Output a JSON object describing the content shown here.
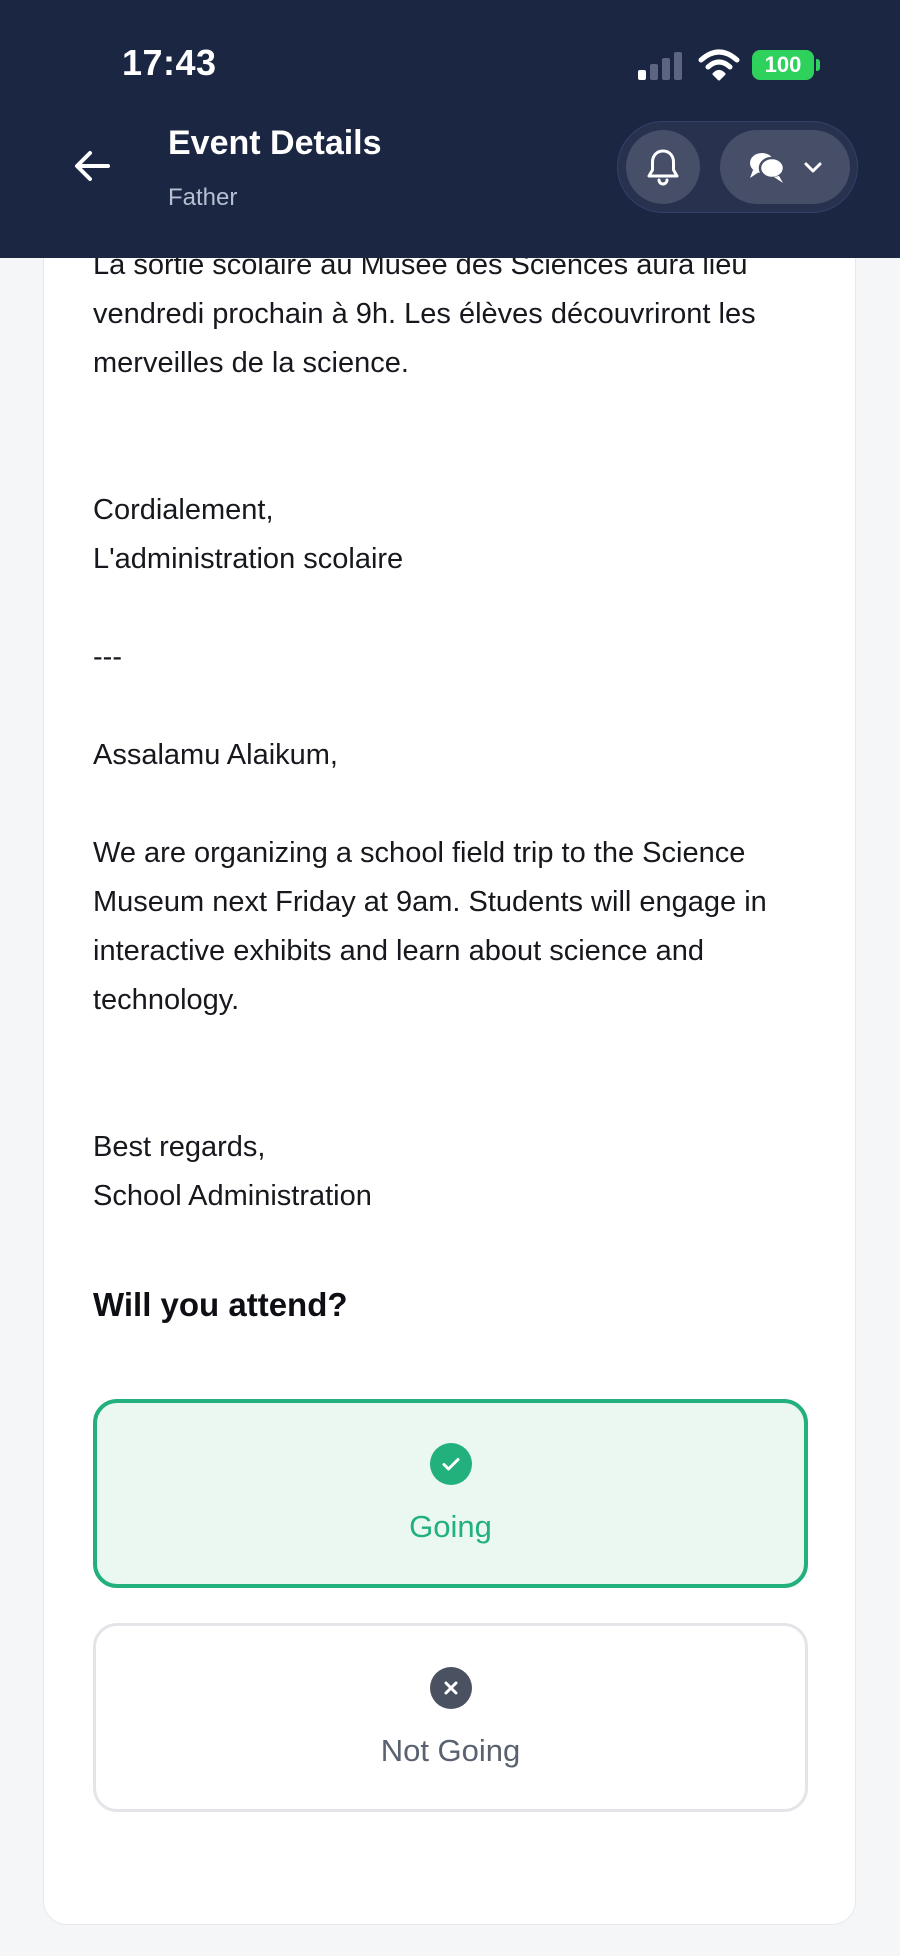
{
  "status_bar": {
    "time": "17:43",
    "battery": "100"
  },
  "header": {
    "title": "Event Details",
    "subtitle": "Father"
  },
  "message": {
    "fr_cut": "La sortie scolaire au Musée des Sciences aura lieu vendredi prochain à 9h. Les élèves découvriront les merveilles de la science.",
    "fr_signoff": "Cordialement,\nL'administration scolaire",
    "divider": "---",
    "en_greeting": "Assalamu Alaikum,",
    "en_body": "We are organizing a school field trip to the Science Museum next Friday at 9am. Students will engage in interactive exhibits and learn about science and technology.",
    "en_signoff": "Best regards,\nSchool Administration"
  },
  "rsvp": {
    "question": "Will you attend?",
    "going_label": "Going",
    "not_going_label": "Not Going",
    "selected": "Going"
  },
  "colors": {
    "header_bg": "#1b2643",
    "accent_green": "#22b07d",
    "selected_bg": "#eaf8f1"
  },
  "icons": {
    "back": "arrow-left-icon",
    "bell": "bell-icon",
    "chat": "chat-bubbles-icon",
    "dropdown": "chevron-down-icon",
    "going": "check-circle-icon",
    "not_going": "x-circle-icon"
  }
}
